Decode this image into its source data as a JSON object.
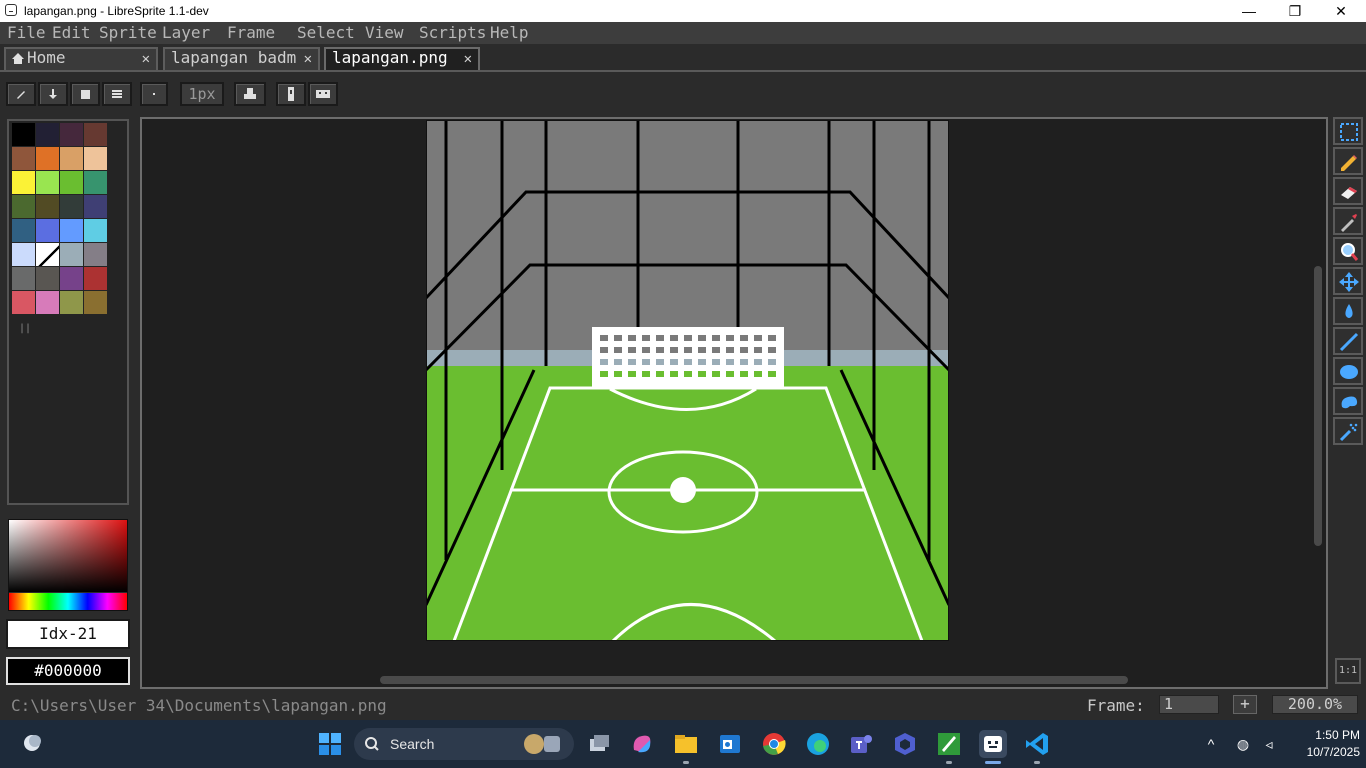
{
  "window": {
    "title": "lapangan.png - LibreSprite 1.1-dev",
    "min": "—",
    "max": "❐",
    "close": "✕"
  },
  "menu": [
    "File",
    "Edit",
    "Sprite",
    "Layer",
    "Frame",
    "Select",
    "View",
    "Scripts",
    "Help"
  ],
  "tabs": [
    {
      "label": "Home",
      "close": "✕"
    },
    {
      "label": "lapangan badm",
      "close": "✕"
    },
    {
      "label": "lapangan.png",
      "close": "✕"
    }
  ],
  "toolbar": {
    "brush_size": "1px"
  },
  "palette": [
    "#000000",
    "#222034",
    "#45283c",
    "#663931",
    "#8f563b",
    "#df7126",
    "#d9a066",
    "#eec39a",
    "#fbf236",
    "#99e550",
    "#6abe30",
    "#37946e",
    "#4b692f",
    "#524b24",
    "#323c39",
    "#3f3f74",
    "#306082",
    "#5b6ee1",
    "#639bff",
    "#5fcde4",
    "#cbdbfc",
    "#ffffff",
    "#9badb7",
    "#847e87",
    "#696a6a",
    "#595652",
    "#76428a",
    "#ac3232",
    "#d95763",
    "#d77bba",
    "#8f974a",
    "#8a6f30"
  ],
  "color": {
    "index_label": "Idx-21",
    "hex": "#000000"
  },
  "status": {
    "path": "C:\\Users\\User 34\\Documents\\lapangan.png",
    "frame_label": "Frame:",
    "frame_value": "1",
    "zoom": "200.0%",
    "ratio": "1:1",
    "plus": "+"
  },
  "taskbar": {
    "search_label": "Search",
    "time": "1:50 PM",
    "date": "10/7/2025"
  },
  "colors": {
    "field_green": "#6abe30",
    "wall_gray": "#7a7a7a",
    "skirting": "#9badb7",
    "line_white": "#ffffff",
    "editor_bg": "#1f1f1f"
  }
}
